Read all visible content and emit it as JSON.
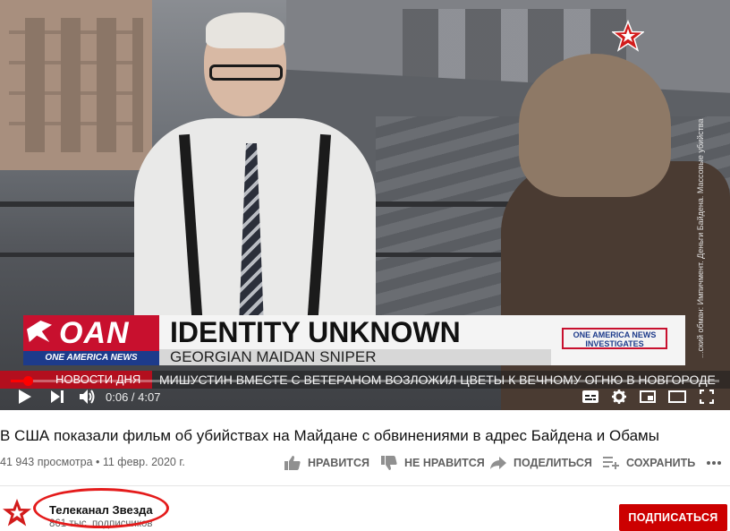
{
  "video": {
    "lower_third": {
      "network_logo": "OAN",
      "network_name": "ONE AMERICA NEWS",
      "headline": "IDENTITY UNKNOWN",
      "subheadline": "GEORGIAN MAIDAN SNIPER",
      "show_badge": "ONE AMERICA NEWS INVESTIGATES"
    },
    "ticker_label": "НОВОСТИ ДНЯ",
    "ticker_text": "МИШУСТИН ВМЕСТЕ С ВЕТЕРАНОМ ВОЗЛОЖИЛ ЦВЕТЫ К ВЕЧНОМУ ОГНЮ В НОВГОРОДЕ",
    "side_text": "...ский обман: Импичмент. Деньги Байдена. Массовые убийства",
    "logo_icon": "zvezda-star-icon",
    "player": {
      "current_time": "0:06",
      "duration": "4:07",
      "time_display": "0:06 / 4:07",
      "progress_fraction": 0.024,
      "accent_color": "#ff0000",
      "icons": [
        "play-icon",
        "next-icon",
        "volume-icon",
        "subtitles-icon",
        "settings-icon",
        "miniplayer-icon",
        "theater-icon",
        "fullscreen-icon"
      ]
    }
  },
  "title": "В США показали фильм об убийствах на Майдане с обвинениями в адрес Байдена и Обамы",
  "meta": "41 943 просмотра • 11 февр. 2020 г.",
  "actions": {
    "like": "НРАВИТСЯ",
    "dislike": "НЕ НРАВИТСЯ",
    "share": "ПОДЕЛИТЬСЯ",
    "save": "СОХРАНИТЬ",
    "more_icon": "more-icon"
  },
  "channel": {
    "name": "Телеканал Звезда",
    "subscribers": "861 тыс. подписчиков",
    "subscribe_label": "ПОДПИСАТЬСЯ",
    "subscribe_color": "#cc0000",
    "annotation_color": "#e41b1b"
  }
}
